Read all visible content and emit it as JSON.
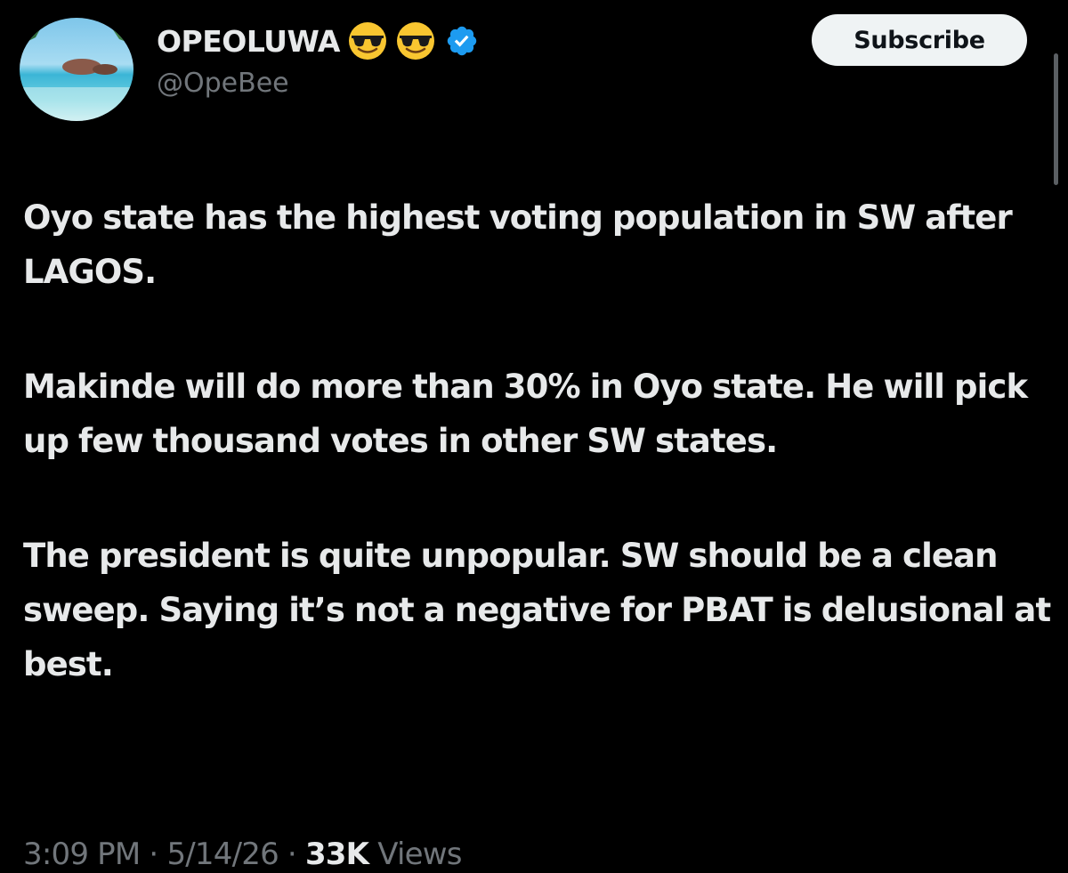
{
  "author": {
    "display_name": "OPEOLUWA",
    "handle": "@OpeBee",
    "emojis": [
      "sunglasses-emoji",
      "sunglasses-emoji"
    ],
    "verified": true
  },
  "actions": {
    "subscribe_label": "Subscribe"
  },
  "tweet": {
    "paragraphs": [
      "Oyo state has the highest voting population in SW after LAGOS.",
      "Makinde will do more than 30% in Oyo state. He will pick up few thousand votes in other SW states.",
      "The president is quite unpopular. SW should be a clean sweep. Saying it’s not a negative for PBAT is delusional at best."
    ]
  },
  "meta": {
    "time": "3:09 PM",
    "separator": " · ",
    "date": "5/14/26",
    "views_count": "33K",
    "views_label": " Views"
  },
  "colors": {
    "background": "#000000",
    "primary_text": "#e7e9ea",
    "secondary_text": "#71767b",
    "verified_blue": "#1d9bf0",
    "button_bg": "#eff3f4"
  }
}
